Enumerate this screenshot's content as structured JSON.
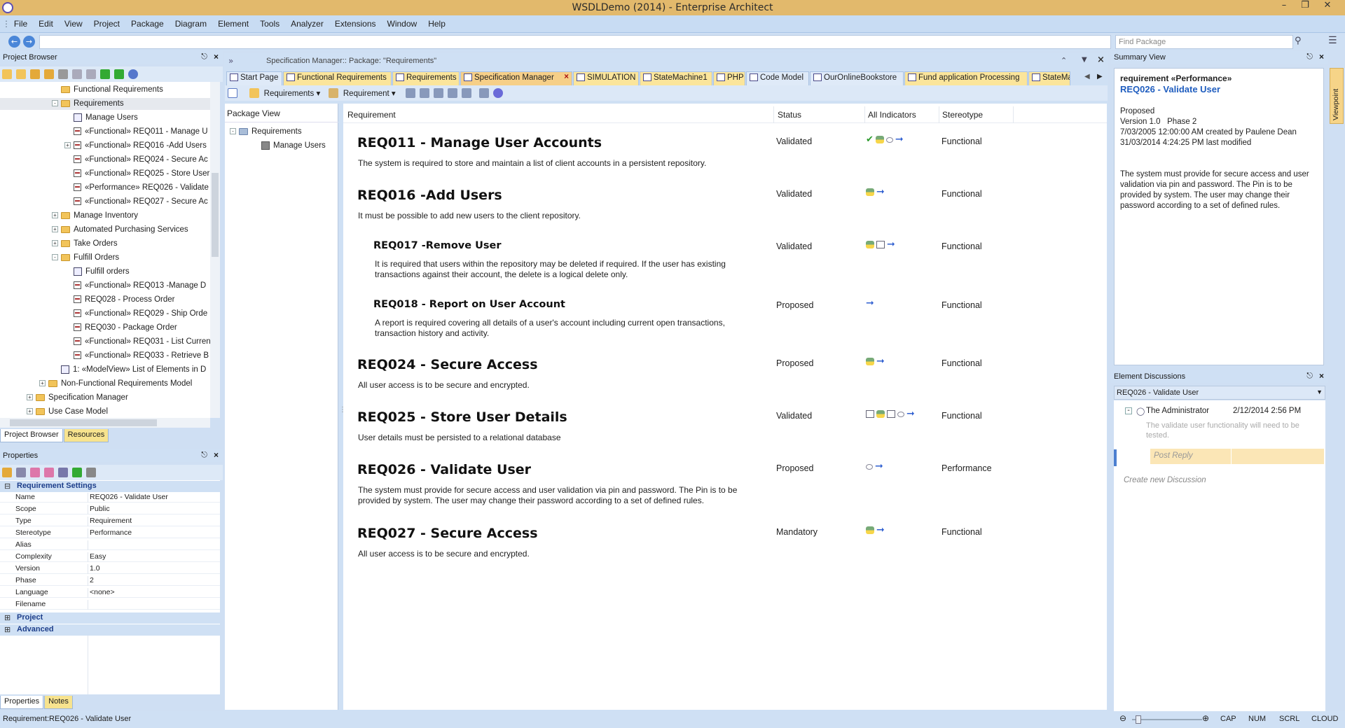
{
  "window": {
    "title": "WSDLDemo (2014) - Enterprise Architect"
  },
  "menu": [
    "File",
    "Edit",
    "View",
    "Project",
    "Package",
    "Diagram",
    "Element",
    "Tools",
    "Analyzer",
    "Extensions",
    "Window",
    "Help"
  ],
  "nav": {
    "find_placeholder": "Find Package"
  },
  "project_browser": {
    "title": "Project Browser",
    "items": [
      {
        "label": "Functional Requirements",
        "icon": "folder-icon",
        "indent": 1,
        "expander": ""
      },
      {
        "label": "Requirements",
        "icon": "folder-icon",
        "indent": 1,
        "expander": "-",
        "selected": true
      },
      {
        "label": "Manage Users",
        "icon": "diagram-icon",
        "indent": 2,
        "expander": ""
      },
      {
        "label": "«Functional» REQ011 - Manage U",
        "icon": "requirement-icon",
        "indent": 2,
        "expander": ""
      },
      {
        "label": "«Functional» REQ016 -Add Users",
        "icon": "requirement-icon",
        "indent": 2,
        "expander": "+"
      },
      {
        "label": "«Functional» REQ024 - Secure Ac",
        "icon": "requirement-icon",
        "indent": 2,
        "expander": ""
      },
      {
        "label": "«Functional» REQ025 - Store User",
        "icon": "requirement-icon",
        "indent": 2,
        "expander": ""
      },
      {
        "label": "«Performance» REQ026 - Validate",
        "icon": "requirement-icon",
        "indent": 2,
        "expander": ""
      },
      {
        "label": "«Functional» REQ027 - Secure Ac",
        "icon": "requirement-icon",
        "indent": 2,
        "expander": ""
      },
      {
        "label": "Manage Inventory",
        "icon": "folder-icon",
        "indent": 1,
        "expander": "+"
      },
      {
        "label": "Automated Purchasing Services",
        "icon": "folder-icon",
        "indent": 1,
        "expander": "+"
      },
      {
        "label": "Take Orders",
        "icon": "folder-icon",
        "indent": 1,
        "expander": "+"
      },
      {
        "label": "Fulfill Orders",
        "icon": "folder-icon",
        "indent": 1,
        "expander": "-"
      },
      {
        "label": "Fulfill orders",
        "icon": "diagram-icon",
        "indent": 2,
        "expander": ""
      },
      {
        "label": "«Functional» REQ013 -Manage D",
        "icon": "requirement-icon",
        "indent": 2,
        "expander": ""
      },
      {
        "label": "REQ028 - Process Order",
        "icon": "requirement-icon",
        "indent": 2,
        "expander": ""
      },
      {
        "label": "«Functional» REQ029 - Ship Orde",
        "icon": "requirement-icon",
        "indent": 2,
        "expander": ""
      },
      {
        "label": "REQ030 - Package Order",
        "icon": "requirement-icon",
        "indent": 2,
        "expander": ""
      },
      {
        "label": "«Functional» REQ031 - List Curren",
        "icon": "requirement-icon",
        "indent": 2,
        "expander": ""
      },
      {
        "label": "«Functional» REQ033 - Retrieve B",
        "icon": "requirement-icon",
        "indent": 2,
        "expander": ""
      },
      {
        "label": "1: «ModelView» List of Elements in D",
        "icon": "modelview-icon",
        "indent": 1,
        "expander": ""
      },
      {
        "label": "Non-Functional Requirements Model",
        "icon": "folder-icon",
        "indent": 0,
        "expander": "+"
      },
      {
        "label": "Specification Manager",
        "icon": "folder-icon",
        "indent": -1,
        "expander": "+"
      },
      {
        "label": "Use Case Model",
        "icon": "folder-icon",
        "indent": -1,
        "expander": "+"
      }
    ],
    "tabs": [
      "Project Browser",
      "Resources"
    ]
  },
  "properties": {
    "title": "Properties",
    "section": "Requirement Settings",
    "rows": [
      {
        "key": "Name",
        "value": "REQ026 - Validate User"
      },
      {
        "key": "Scope",
        "value": "Public"
      },
      {
        "key": "Type",
        "value": "Requirement"
      },
      {
        "key": "Stereotype",
        "value": "Performance"
      },
      {
        "key": "Alias",
        "value": ""
      },
      {
        "key": "Complexity",
        "value": "Easy"
      },
      {
        "key": "Version",
        "value": "1.0"
      },
      {
        "key": "Phase",
        "value": "2"
      },
      {
        "key": "Language",
        "value": "<none>"
      },
      {
        "key": "Filename",
        "value": ""
      }
    ],
    "sections_collapsed": [
      "Project",
      "Advanced"
    ],
    "tabs": [
      "Properties",
      "Notes"
    ]
  },
  "document": {
    "breadcrumb": "Specification Manager::  Package: \"Requirements\"",
    "tabs": [
      {
        "label": "Start Page",
        "style": "plain"
      },
      {
        "label": "Functional Requirements",
        "style": "yellow"
      },
      {
        "label": "Requirements",
        "style": "yellow"
      },
      {
        "label": "Specification Manager",
        "style": "active"
      },
      {
        "label": "SIMULATION",
        "style": "yellow"
      },
      {
        "label": "StateMachine1",
        "style": "yellow"
      },
      {
        "label": "PHP",
        "style": "yellow"
      },
      {
        "label": "Code Model",
        "style": "plain"
      },
      {
        "label": "OurOnlineBookstore",
        "style": "plain"
      },
      {
        "label": "Fund application Processing",
        "style": "yellow"
      },
      {
        "label": "StateMac",
        "style": "yellow"
      }
    ],
    "close_tab_glyph": "×",
    "toolbar": {
      "package_dropdown": "Requirements",
      "type_dropdown": "Requirement"
    }
  },
  "spec": {
    "package_view": {
      "title": "Package View",
      "root": "Requirements",
      "child": "Manage Users"
    },
    "columns": {
      "requirement": "Requirement",
      "status": "Status",
      "indicators": "All Indicators",
      "stereotype": "Stereotype"
    },
    "rows": [
      {
        "title": "REQ011 - Manage User Accounts",
        "desc": "The system is required to store and maintain a list of client accounts in a persistent repository.",
        "status": "Validated",
        "stereotype": "Functional",
        "level": 1,
        "indicators": [
          "check-icon",
          "actor-icon",
          "comment-icon",
          "arrow-icon"
        ]
      },
      {
        "title": "REQ016 -Add Users",
        "desc": "It must be possible to add new users to the client repository.",
        "status": "Validated",
        "stereotype": "Functional",
        "level": 1,
        "indicators": [
          "actor-icon",
          "arrow-icon"
        ]
      },
      {
        "title": "REQ017 -Remove User",
        "desc": "It is required that users within the repository may be deleted if required. If the user has existing transactions against their account, the delete is a logical delete only.",
        "status": "Validated",
        "stereotype": "Functional",
        "level": 2,
        "indicators": [
          "actor-icon",
          "document-icon",
          "arrow-icon"
        ]
      },
      {
        "title": "REQ018 - Report on User Account",
        "desc": "A report is required covering all details of a user's account including current open transactions, transaction history and activity.",
        "status": "Proposed",
        "stereotype": "Functional",
        "level": 2,
        "indicators": [
          "arrow-icon"
        ]
      },
      {
        "title": "REQ024 - Secure Access",
        "desc": "All user access is to be secure and encrypted.",
        "status": "Proposed",
        "stereotype": "Functional",
        "level": 1,
        "indicators": [
          "actor-icon",
          "arrow-icon"
        ]
      },
      {
        "title": "REQ025 - Store User Details",
        "desc": "User details must be persisted to a relational database",
        "status": "Validated",
        "stereotype": "Functional",
        "level": 1,
        "indicators": [
          "document-icon",
          "actor-icon",
          "document-icon",
          "comment-icon",
          "arrow-icon"
        ]
      },
      {
        "title": "REQ026 - Validate User",
        "desc": "The system must provide for secure access and user validation via pin and password. The Pin is to be provided by system. The user may change their password according to a set of defined rules.",
        "status": "Proposed",
        "stereotype": "Performance",
        "level": 1,
        "indicators": [
          "comment-icon",
          "arrow-icon"
        ]
      },
      {
        "title": "REQ027 - Secure Access",
        "desc": "All user access is to be secure and encrypted.",
        "status": "Mandatory",
        "stereotype": "Functional",
        "level": 1,
        "indicators": [
          "actor-icon",
          "arrow-icon"
        ]
      }
    ]
  },
  "summary": {
    "title": "Summary View",
    "kind": "requirement  «Performance»",
    "name": "REQ026 - Validate User",
    "status": "Proposed",
    "version": "Version 1.0   Phase 2",
    "created": "7/03/2005 12:00:00 AM created by Paulene Dean",
    "modified": "31/03/2014 4:24:25 PM last modified",
    "notes": "The system must provide for secure access and user validation via pin and password. The Pin is to be provided by system. The user may change their password according to a set of defined rules.",
    "side_tab": "Viewpoint"
  },
  "discussions": {
    "title": "Element Discussions",
    "element": "REQ026 - Validate User",
    "author": "The Administrator",
    "date": "2/12/2014 2:56 PM",
    "message": "The validate user functionality will need to be tested.",
    "reply_placeholder": "Post Reply",
    "create_new": "Create new Discussion"
  },
  "statusbar": {
    "text": "Requirement:REQ026 - Validate User",
    "indicators": [
      "CAP",
      "NUM",
      "SCRL",
      "CLOUD"
    ],
    "zoom_fraction": 0.05
  }
}
